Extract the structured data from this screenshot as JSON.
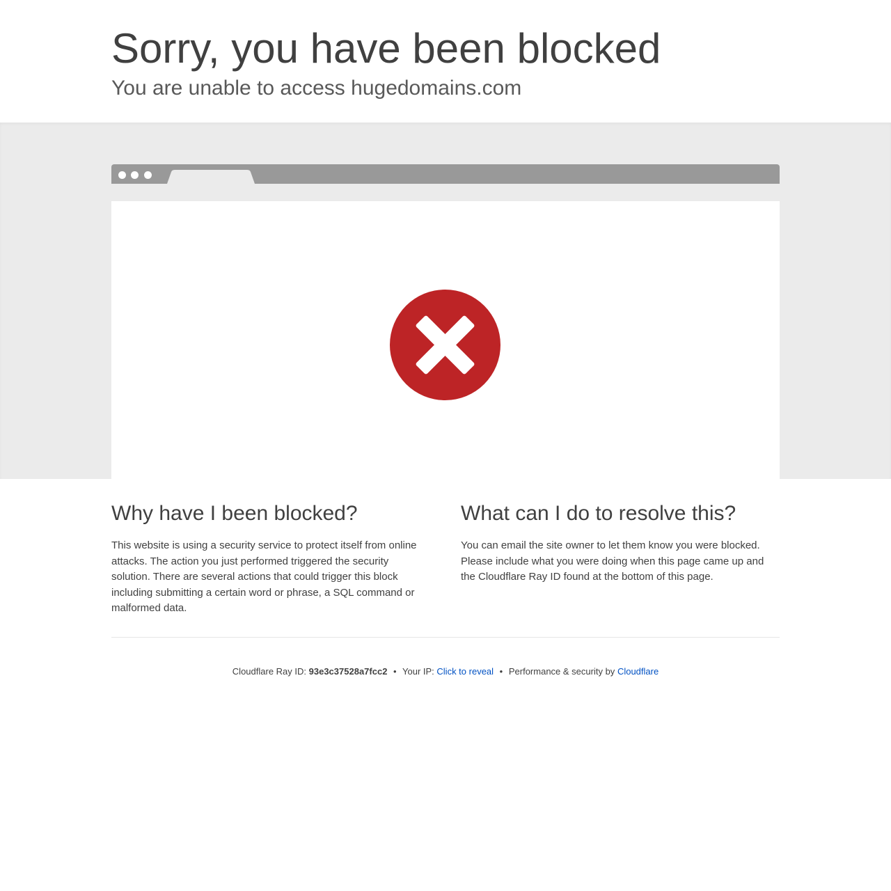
{
  "header": {
    "title": "Sorry, you have been blocked",
    "subtitle": "You are unable to access hugedomains.com"
  },
  "browser_mock": {
    "icon": "block-x-icon",
    "icon_color": "#bd2426"
  },
  "why_section": {
    "heading": "Why have I been blocked?",
    "body": "This website is using a security service to protect itself from online attacks. The action you just performed triggered the security solution. There are several actions that could trigger this block including submitting a certain word or phrase, a SQL command or malformed data."
  },
  "resolve_section": {
    "heading": "What can I do to resolve this?",
    "body": "You can email the site owner to let them know you were blocked. Please include what you were doing when this page came up and the Cloudflare Ray ID found at the bottom of this page."
  },
  "footer": {
    "ray_label": "Cloudflare Ray ID:",
    "ray_id": "93e3c37528a7fcc2",
    "separator": "•",
    "ip_label": "Your IP:",
    "ip_link": "Click to reveal",
    "perf_label": "Performance & security by",
    "perf_link": "Cloudflare",
    "link_color": "#0051c3"
  }
}
